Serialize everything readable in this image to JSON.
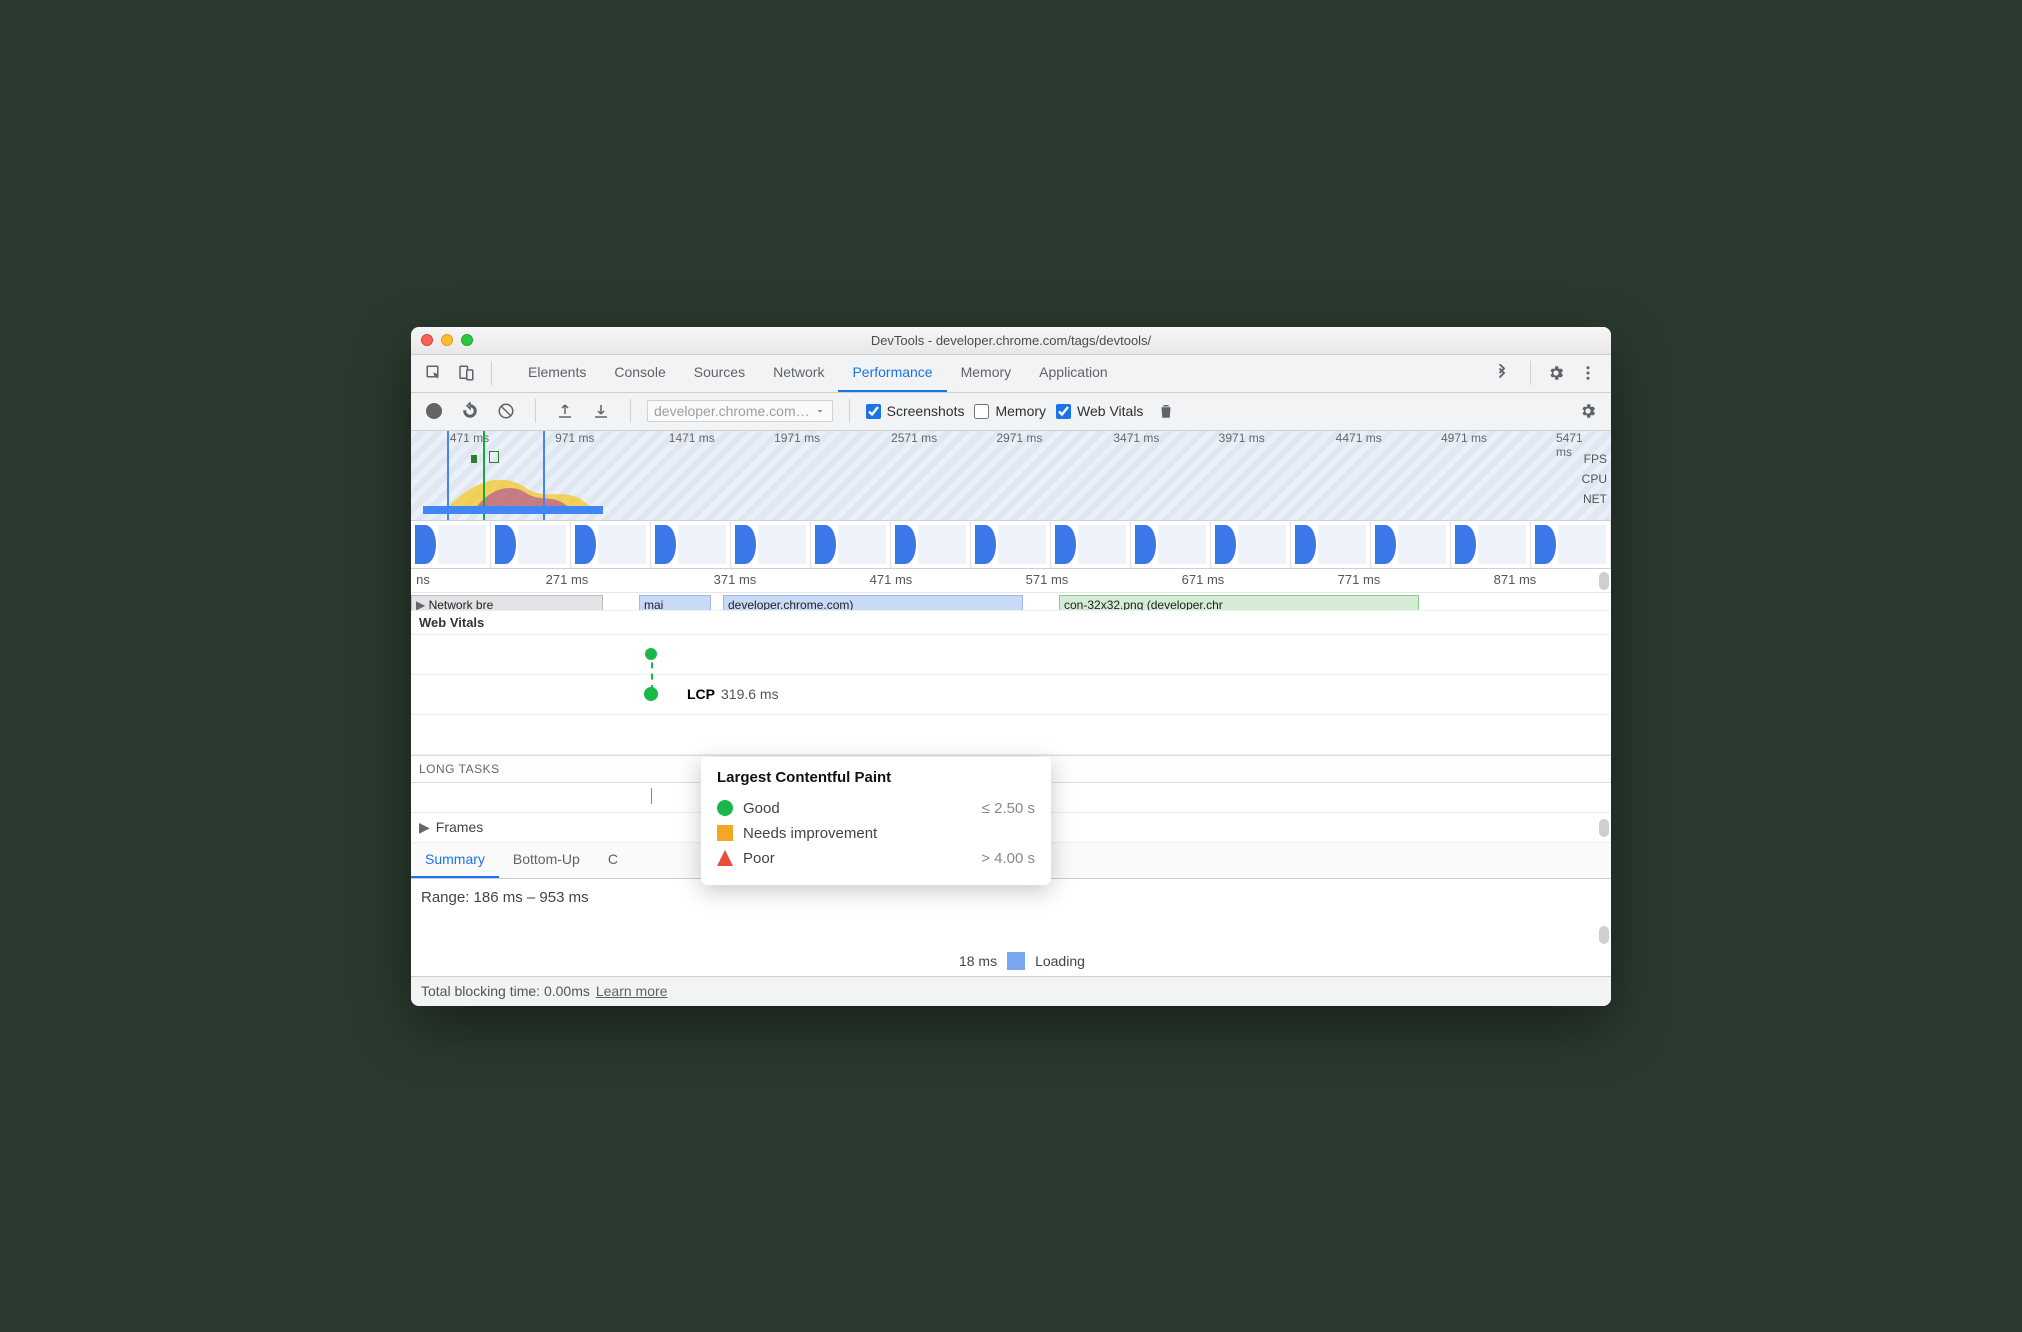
{
  "title": "DevTools - developer.chrome.com/tags/devtools/",
  "tabs": [
    "Elements",
    "Console",
    "Sources",
    "Network",
    "Performance",
    "Memory",
    "Application"
  ],
  "activeTab": "Performance",
  "toolbar": {
    "recording_selector": "developer.chrome.com…",
    "screenshots_label": "Screenshots",
    "memory_label": "Memory",
    "webvitals_label": "Web Vitals",
    "screenshots_checked": true,
    "memory_checked": false,
    "webvitals_checked": true
  },
  "overview": {
    "ticks": [
      "471 ms",
      "971 ms",
      "1471 ms",
      "1971 ms",
      "2571 ms",
      "2971 ms",
      "3471 ms",
      "3971 ms",
      "4471 ms",
      "4971 ms",
      "5471 ms"
    ],
    "labels": {
      "fps": "FPS",
      "cpu": "CPU",
      "net": "NET"
    }
  },
  "flame": {
    "ticks": [
      "ns",
      "271 ms",
      "371 ms",
      "471 ms",
      "571 ms",
      "671 ms",
      "771 ms",
      "871 ms"
    ],
    "bars": {
      "network": "Network bre",
      "main": "mai",
      "devcom": "developer.chrome.com)",
      "icon": "con-32x32.png (developer.chr"
    }
  },
  "webvitals": {
    "header": "Web Vitals",
    "lcp_label": "LCP",
    "lcp_value": "319.6 ms",
    "longtasks_header": "LONG TASKS",
    "frames_label": "Frames"
  },
  "tooltip": {
    "title": "Largest Contentful Paint",
    "good": "Good",
    "good_th": "≤ 2.50 s",
    "ni": "Needs improvement",
    "poor": "Poor",
    "poor_th": "> 4.00 s"
  },
  "details": {
    "tabs": [
      "Summary",
      "Bottom-Up"
    ],
    "active": "Summary",
    "third_tab_partial": "C",
    "range": "Range: 186 ms – 953 ms",
    "loading_value": "18 ms",
    "loading_label": "Loading"
  },
  "footer": {
    "tbt": "Total blocking time: 0.00ms",
    "learn": "Learn more"
  }
}
